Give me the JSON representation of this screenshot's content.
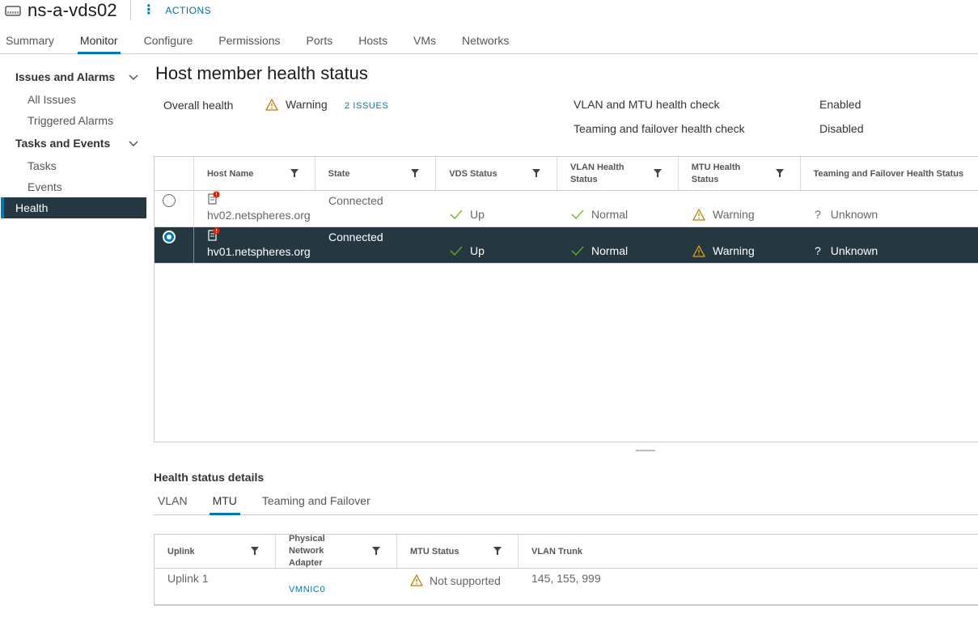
{
  "header": {
    "title": "ns-a-vds02",
    "object_icon": "distributed-switch-icon",
    "actions_label": "ACTIONS"
  },
  "top_tabs": [
    {
      "label": "Summary",
      "active": false
    },
    {
      "label": "Monitor",
      "active": true
    },
    {
      "label": "Configure",
      "active": false
    },
    {
      "label": "Permissions",
      "active": false
    },
    {
      "label": "Ports",
      "active": false
    },
    {
      "label": "Hosts",
      "active": false
    },
    {
      "label": "VMs",
      "active": false
    },
    {
      "label": "Networks",
      "active": false
    }
  ],
  "sidebar": {
    "groups": [
      {
        "label": "Issues and Alarms",
        "items": [
          "All Issues",
          "Triggered Alarms"
        ]
      },
      {
        "label": "Tasks and Events",
        "items": [
          "Tasks",
          "Events"
        ]
      }
    ],
    "health_label": "Health"
  },
  "page": {
    "title": "Host member health status",
    "overall_health_label": "Overall health",
    "overall_health_value": "Warning",
    "issues_link": "2 ISSUES",
    "vlan_mtu_label": "VLAN and MTU health check",
    "vlan_mtu_value": "Enabled",
    "teaming_label": "Teaming and failover health check",
    "teaming_value": "Disabled"
  },
  "hosts_grid": {
    "columns": [
      "Host Name",
      "State",
      "VDS Status",
      "VLAN Health Status",
      "MTU Health Status",
      "Teaming and Failover Health Status"
    ],
    "rows": [
      {
        "host": "hv02.netspheres.org",
        "state": "Connected",
        "vds": "Up",
        "vlan": "Normal",
        "mtu": "Warning",
        "teaming": "Unknown",
        "selected": false
      },
      {
        "host": "hv01.netspheres.org",
        "state": "Connected",
        "vds": "Up",
        "vlan": "Normal",
        "mtu": "Warning",
        "teaming": "Unknown",
        "selected": true
      }
    ]
  },
  "details": {
    "title": "Health status details",
    "tabs": [
      {
        "label": "VLAN",
        "active": false
      },
      {
        "label": "MTU",
        "active": true
      },
      {
        "label": "Teaming and Failover",
        "active": false
      }
    ],
    "columns": [
      "Uplink",
      "Physical Network Adapter",
      "MTU Status",
      "VLAN Trunk"
    ],
    "rows": [
      {
        "uplink": "Uplink 1",
        "adapter": "VMNIC0",
        "mtu_status": "Not supported",
        "vlan_trunk": "145, 155, 999"
      }
    ]
  },
  "colors": {
    "accent": "#0079b8",
    "selected_row": "#253842",
    "ok_green": "#5eb715",
    "warning": "#c27b00"
  }
}
